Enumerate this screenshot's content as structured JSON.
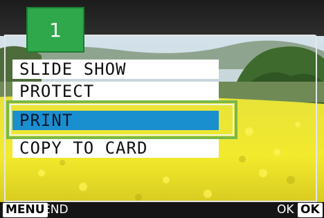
{
  "folder_tab": "1",
  "menu": {
    "items": [
      {
        "label": "SLIDE SHOW"
      },
      {
        "label": "PROTECT"
      },
      {
        "label": "PRINT"
      },
      {
        "label": "COPY TO CARD"
      }
    ],
    "selected_index": 2
  },
  "footer": {
    "menu_key": "MENU",
    "menu_action": "END",
    "ok_action": "OK",
    "ok_key": "OK"
  },
  "colors": {
    "tab": "#2ea84a",
    "selection": "#1a8fd0",
    "highlight_frame": "#7ab84a"
  }
}
